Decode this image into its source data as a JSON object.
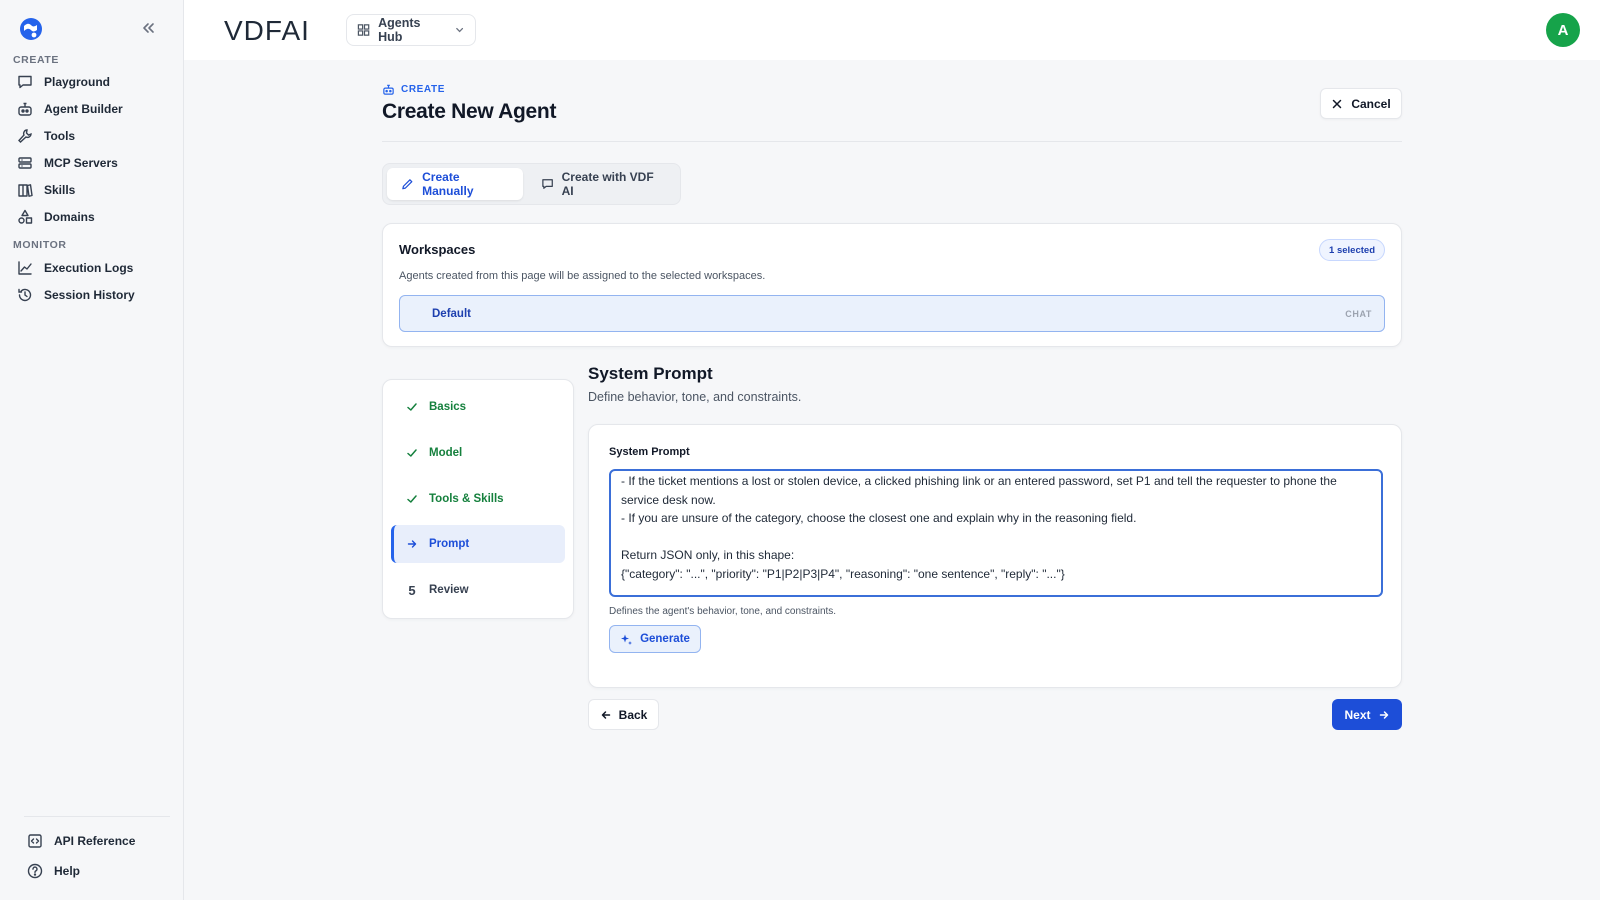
{
  "sidebar": {
    "create_label": "CREATE",
    "monitor_label": "MONITOR",
    "create_items": [
      {
        "label": "Playground",
        "icon": "chat-icon"
      },
      {
        "label": "Agent Builder",
        "icon": "robot-icon"
      },
      {
        "label": "Tools",
        "icon": "wrench-icon"
      },
      {
        "label": "MCP Servers",
        "icon": "server-icon"
      },
      {
        "label": "Skills",
        "icon": "book-icon"
      },
      {
        "label": "Domains",
        "icon": "shapes-icon"
      }
    ],
    "monitor_items": [
      {
        "label": "Execution Logs",
        "icon": "chart-line-icon"
      },
      {
        "label": "Session History",
        "icon": "history-icon"
      }
    ],
    "footer_items": [
      {
        "label": "API Reference",
        "icon": "code-icon"
      },
      {
        "label": "Help",
        "icon": "help-icon"
      }
    ]
  },
  "topbar": {
    "brand": "VDFAI",
    "hub_label": "Agents Hub",
    "avatar_initial": "A",
    "avatar_color": "#16a34a"
  },
  "header": {
    "crumb": "CREATE",
    "title": "Create New Agent",
    "cancel_label": "Cancel"
  },
  "mode_tabs": [
    {
      "label": "Create Manually",
      "active": true
    },
    {
      "label": "Create with VDF AI",
      "active": false
    }
  ],
  "workspaces": {
    "title": "Workspaces",
    "badge": "1 selected",
    "description": "Agents created from this page will be assigned to the selected workspaces.",
    "options": [
      {
        "name": "Default",
        "tag": "CHAT",
        "selected": true
      }
    ]
  },
  "steps": [
    {
      "label": "Basics",
      "state": "done"
    },
    {
      "label": "Model",
      "state": "done"
    },
    {
      "label": "Tools & Skills",
      "state": "done"
    },
    {
      "label": "Prompt",
      "state": "active"
    },
    {
      "label": "Review",
      "state": "todo",
      "number": "5"
    }
  ],
  "prompt_section": {
    "title": "System Prompt",
    "subtitle": "Define behavior, tone, and constraints.",
    "field_label": "System Prompt",
    "value": "- If the ticket mentions a lost or stolen device, a clicked phishing link or an entered password, set P1 and tell the requester to phone the service desk now.\n- If you are unsure of the category, choose the closest one and explain why in the reasoning field.\n\nReturn JSON only, in this shape:\n{\"category\": \"...\", \"priority\": \"P1|P2|P3|P4\", \"reasoning\": \"one sentence\", \"reply\": \"...\"}",
    "help": "Defines the agent's behavior, tone, and constraints.",
    "generate_label": "Generate"
  },
  "nav_buttons": {
    "back_label": "Back",
    "next_label": "Next"
  },
  "colors": {
    "accent": "#1d4ed8",
    "done": "#15803d"
  }
}
